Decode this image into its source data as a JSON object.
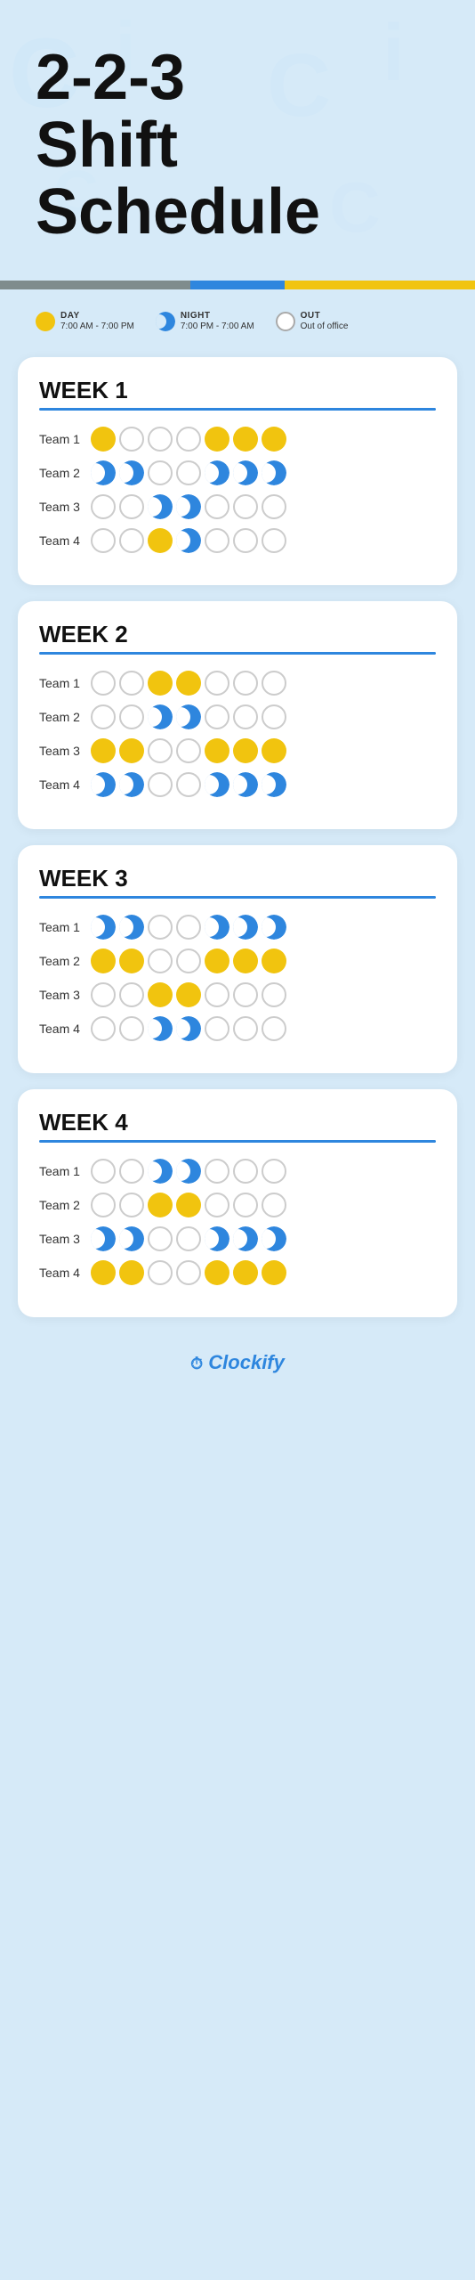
{
  "header": {
    "title_line1": "2-2-3",
    "title_line2": "Shift",
    "title_line3": "Schedule"
  },
  "legend": {
    "day_label": "DAY",
    "day_time": "7:00 AM - 7:00 PM",
    "night_label": "NIGHT",
    "night_time": "7:00 PM - 7:00 AM",
    "out_label": "OUT",
    "out_desc": "Out of office"
  },
  "weeks": [
    {
      "title": "WEEK 1",
      "teams": [
        {
          "label": "Team 1",
          "shifts": [
            "day",
            "out",
            "out",
            "out",
            "day",
            "day",
            "day"
          ]
        },
        {
          "label": "Team 2",
          "shifts": [
            "night",
            "night",
            "out",
            "out",
            "night",
            "night",
            "night"
          ]
        },
        {
          "label": "Team 3",
          "shifts": [
            "out",
            "out",
            "night",
            "night",
            "out",
            "out",
            "out"
          ]
        },
        {
          "label": "Team 4",
          "shifts": [
            "out",
            "out",
            "day",
            "night",
            "out",
            "out",
            "out"
          ]
        }
      ]
    },
    {
      "title": "WEEK 2",
      "teams": [
        {
          "label": "Team 1",
          "shifts": [
            "out",
            "out",
            "day",
            "day",
            "out",
            "out",
            "out"
          ]
        },
        {
          "label": "Team 2",
          "shifts": [
            "out",
            "out",
            "night",
            "night",
            "out",
            "out",
            "out"
          ]
        },
        {
          "label": "Team 3",
          "shifts": [
            "day",
            "day",
            "out",
            "out",
            "day",
            "day",
            "day"
          ]
        },
        {
          "label": "Team 4",
          "shifts": [
            "night",
            "night",
            "out",
            "out",
            "night",
            "night",
            "night"
          ]
        }
      ]
    },
    {
      "title": "WEEK 3",
      "teams": [
        {
          "label": "Team 1",
          "shifts": [
            "night",
            "night",
            "out",
            "out",
            "night",
            "night",
            "night"
          ]
        },
        {
          "label": "Team 2",
          "shifts": [
            "day",
            "day",
            "out",
            "out",
            "day",
            "day",
            "day"
          ]
        },
        {
          "label": "Team 3",
          "shifts": [
            "out",
            "out",
            "day",
            "day",
            "out",
            "out",
            "out"
          ]
        },
        {
          "label": "Team 4",
          "shifts": [
            "out",
            "out",
            "night",
            "night",
            "out",
            "out",
            "out"
          ]
        }
      ]
    },
    {
      "title": "WEEK 4",
      "teams": [
        {
          "label": "Team 1",
          "shifts": [
            "out",
            "out",
            "night",
            "night",
            "out",
            "out",
            "out"
          ]
        },
        {
          "label": "Team 2",
          "shifts": [
            "out",
            "out",
            "day",
            "day",
            "out",
            "out",
            "out"
          ]
        },
        {
          "label": "Team 3",
          "shifts": [
            "night",
            "night",
            "out",
            "out",
            "night",
            "night",
            "night"
          ]
        },
        {
          "label": "Team 4",
          "shifts": [
            "day",
            "day",
            "out",
            "out",
            "day",
            "day",
            "day"
          ]
        }
      ]
    }
  ],
  "footer": {
    "logo": "Clockify"
  }
}
